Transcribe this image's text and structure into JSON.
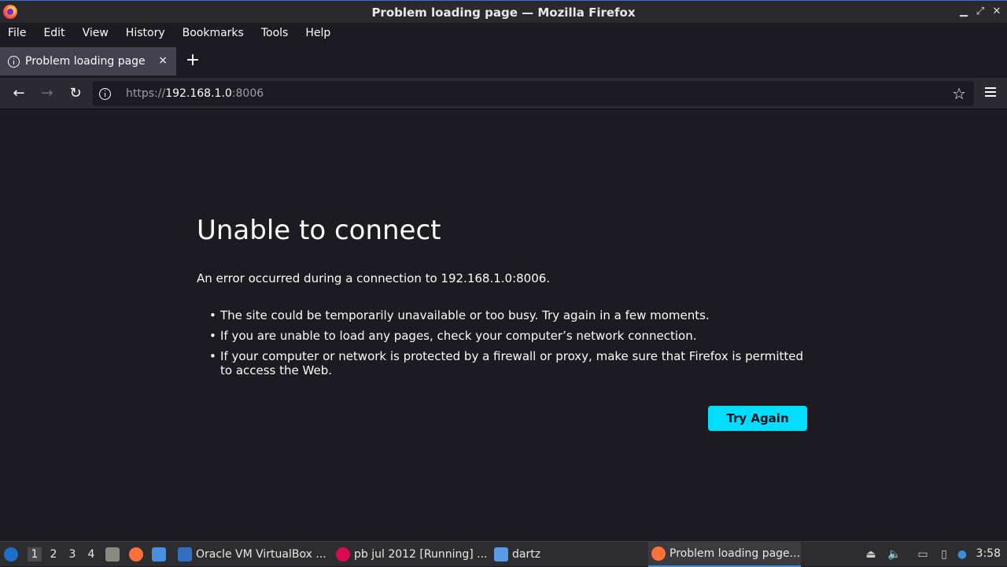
{
  "window": {
    "title": "Problem loading page — Mozilla Firefox",
    "minimize_glyph": "▁",
    "maximize_glyph": "⤢",
    "close_glyph": "✕"
  },
  "menu": [
    "File",
    "Edit",
    "View",
    "History",
    "Bookmarks",
    "Tools",
    "Help"
  ],
  "tab": {
    "label": "Problem loading page",
    "close_glyph": "×",
    "new_tab_glyph": "+"
  },
  "nav": {
    "back_glyph": "←",
    "forward_glyph": "→",
    "reload_glyph": "↻",
    "url_scheme": "https://",
    "url_host": "192.168.1.0",
    "url_port": ":8006",
    "bookmark_glyph": "☆"
  },
  "error_page": {
    "title": "Unable to connect",
    "description": "An error occurred during a connection to 192.168.1.0:8006.",
    "bullets": [
      "The site could be temporarily unavailable or too busy. Try again in a few moments.",
      "If you are unable to load any pages, check your computer’s network connection.",
      "If your computer or network is protected by a firewall or proxy, make sure that Firefox is permitted to access the Web."
    ],
    "button_label": "Try Again",
    "accent_color": "#00ddff"
  },
  "taskbar": {
    "workspaces": [
      "1",
      "2",
      "3",
      "4"
    ],
    "tasks": [
      {
        "label": "Oracle VM VirtualBox ...",
        "icon": "virtualbox-icon"
      },
      {
        "label": "pb jul 2012 [Running] ...",
        "icon": "debian-icon"
      },
      {
        "label": "dartz",
        "icon": "folder-icon"
      },
      {
        "label": "Problem loading page...",
        "icon": "firefox-icon"
      }
    ],
    "clock": "3:58"
  }
}
